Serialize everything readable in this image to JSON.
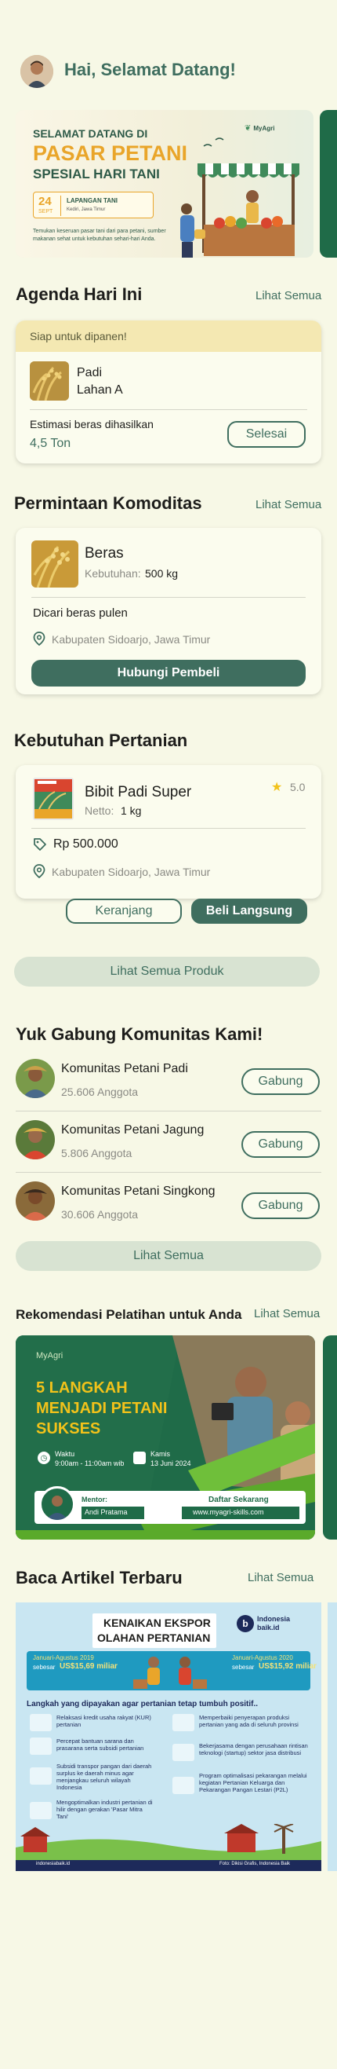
{
  "header": {
    "greeting": "Hai, Selamat Datang!"
  },
  "banner": {
    "line1": "SELAMAT DATANG DI",
    "line2": "PASAR PETANI",
    "line3": "SPESIAL HARI TANI",
    "brand": "MyAgri",
    "date_day": "24",
    "date_month": "SEPT",
    "venue_title": "LAPANGAN TANI",
    "venue_sub": "Kediri, Jawa Timur",
    "desc": "Temukan keseruan pasar tani dari para petani, sumber makanan sehat untuk kebutuhan sehari-hari Anda."
  },
  "agenda": {
    "title": "Agenda Hari Ini",
    "see_all": "Lihat Semua",
    "status": "Siap untuk dipanen!",
    "crop": "Padi",
    "field": "Lahan A",
    "estimate_label": "Estimasi beras dihasilkan",
    "estimate_value": "4,5 Ton",
    "done_button": "Selesai"
  },
  "commodity": {
    "title": "Permintaan Komoditas",
    "see_all": "Lihat Semua",
    "name": "Beras",
    "need_label": "Kebutuhan:",
    "need_value": "500 kg",
    "desc": "Dicari beras pulen",
    "location": "Kabupaten Sidoarjo, Jawa Timur",
    "contact_button": "Hubungi Pembeli"
  },
  "needs": {
    "title": "Kebutuhan Pertanian",
    "product": "Bibit Padi Super",
    "rating": "5.0",
    "netto_label": "Netto:",
    "netto_value": "1 kg",
    "price": "Rp 500.000",
    "location": "Kabupaten Sidoarjo, Jawa Timur",
    "cart_button": "Keranjang",
    "buy_button": "Beli Langsung",
    "see_all_products": "Lihat Semua Produk"
  },
  "community": {
    "title": "Yuk Gabung Komunitas Kami!",
    "items": [
      {
        "name": "Komunitas Petani Padi",
        "members": "25.606 Anggota",
        "button": "Gabung"
      },
      {
        "name": "Komunitas Petani Jagung",
        "members": "5.806 Anggota",
        "button": "Gabung"
      },
      {
        "name": "Komunitas Petani Singkong",
        "members": "30.606 Anggota",
        "button": "Gabung"
      }
    ],
    "see_all": "Lihat Semua"
  },
  "training": {
    "title": "Rekomendasi Pelatihan untuk Anda",
    "see_all": "Lihat Semua",
    "brand": "MyAgri",
    "headline1": "5 LANGKAH",
    "headline2": "MENJADI PETANI",
    "headline3": "SUKSES",
    "time_label": "Waktu",
    "time_value": "9:00am - 11:00am wib",
    "date_label": "Kamis",
    "date_value": "13 Juni 2024",
    "mentor_label": "Mentor:",
    "mentor_name": "Andi Pratama",
    "register_label": "Daftar Sekarang",
    "register_url": "www.myagri-skills.com"
  },
  "articles": {
    "title": "Baca Artikel Terbaru",
    "see_all": "Lihat Semua",
    "headline1": "KENAIKAN EKSPOR",
    "headline2": "OLAHAN PERTANIAN",
    "source": "Indonesia baik.id",
    "left_period": "Januari-Agustus 2019",
    "left_value_prefix": "sebesar",
    "left_value": "US$15,69 miliar",
    "right_period": "Januari-Agustus 2020",
    "right_value_prefix": "sebesar",
    "right_value": "US$15,92 miliar",
    "subhead": "Langkah yang dipayakan agar pertanian tetap tumbuh positif..",
    "points_left": [
      "Relaksasi kredit usaha rakyat (KUR) pertanian",
      "Percepat bantuan sarana dan prasarana serta subsidi pertanian",
      "Subsidi transpor pangan dari daerah surplus ke daerah minus agar menjangkau seluruh wilayah Indonesia",
      "Mengoptimalkan industri pertanian di hilir dengan gerakan 'Pasar Mitra Tani'"
    ],
    "points_right": [
      "Memperbaiki penyerapan produksi pertanian yang ada di seluruh provinsi",
      "Bekerjasama dengan perusahaan rintisan teknologi (startup) sektor jasa distribusi",
      "Program optimalisasi pekarangan melalui kegiatan Pertanian Keluarga dan Pekarangan Pangan Lestari (P2L)"
    ],
    "footer_left": "indonesiabaik.id",
    "footer_right": "Foto: Dikisi Grafis, Indonesia Baik"
  }
}
